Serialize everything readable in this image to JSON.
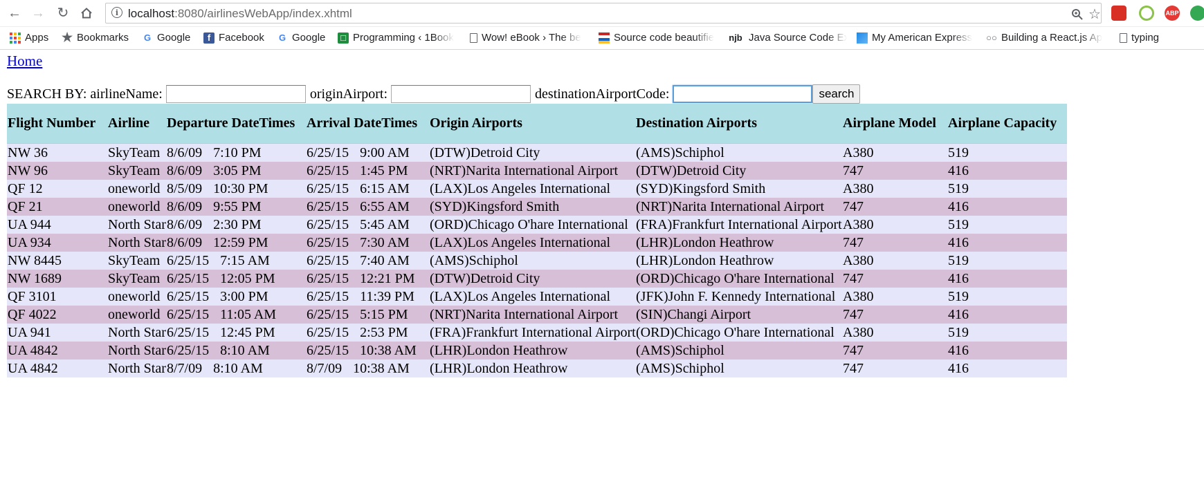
{
  "browser": {
    "url_host": "localhost",
    "url_path": ":8080/airlinesWebApp/index.xhtml",
    "extensions": [
      {
        "name": "red-book-extension",
        "color": "#d93025",
        "label": ""
      },
      {
        "name": "green-q-extension",
        "color": "#4caf50",
        "label": ""
      },
      {
        "name": "adblock-plus-extension",
        "color": "#e53935",
        "label": "ABP"
      },
      {
        "name": "green-circle-extension",
        "color": "#34a853",
        "label": ""
      }
    ]
  },
  "bookmarks": [
    {
      "label": "Apps"
    },
    {
      "label": "Bookmarks"
    },
    {
      "label": "Google"
    },
    {
      "label": "Facebook"
    },
    {
      "label": "Google"
    },
    {
      "label": "Programming ‹ 1Book"
    },
    {
      "label": "Wow! eBook › The be"
    },
    {
      "label": "Source code beautifie"
    },
    {
      "label": "Java Source Code Exa"
    },
    {
      "label": "My American Express"
    },
    {
      "label": "Building a React.js Ap"
    },
    {
      "label": "typing"
    }
  ],
  "bookmark_icons": {
    "google": "G",
    "facebook": "f",
    "njb": "njb"
  },
  "page": {
    "home_link": "Home",
    "search_by": "SEARCH BY: airlineName:",
    "origin_label": "originAirport:",
    "dest_label": "destinationAirportCode:",
    "search_button": "search",
    "airline_value": "",
    "origin_value": "",
    "dest_value": ""
  },
  "table": {
    "headers": [
      "Flight Number",
      "Airline",
      "Departure DateTimes",
      "Arrival DateTimes",
      "Origin Airports",
      "Destination Airports",
      "Airplane Model",
      "Airplane Capacity"
    ],
    "rows": [
      {
        "flight": "NW 36",
        "airline": "SkyTeam",
        "dep_date": "8/6/09",
        "dep_time": "7:10 PM",
        "arr_date": "6/25/15",
        "arr_time": "9:00 AM",
        "origin": "(DTW)Detroid City",
        "dest": "(AMS)Schiphol",
        "model": "A380",
        "capacity": "519"
      },
      {
        "flight": "NW 96",
        "airline": "SkyTeam",
        "dep_date": "8/6/09",
        "dep_time": "3:05 PM",
        "arr_date": "6/25/15",
        "arr_time": "1:45 PM",
        "origin": "(NRT)Narita International Airport",
        "dest": "(DTW)Detroid City",
        "model": "747",
        "capacity": "416"
      },
      {
        "flight": "QF 12",
        "airline": "oneworld",
        "dep_date": "8/5/09",
        "dep_time": "10:30 PM",
        "arr_date": "6/25/15",
        "arr_time": "6:15 AM",
        "origin": "(LAX)Los Angeles International",
        "dest": "(SYD)Kingsford Smith",
        "model": "A380",
        "capacity": "519"
      },
      {
        "flight": "QF 21",
        "airline": "oneworld",
        "dep_date": "8/6/09",
        "dep_time": "9:55 PM",
        "arr_date": "6/25/15",
        "arr_time": "6:55 AM",
        "origin": "(SYD)Kingsford Smith",
        "dest": "(NRT)Narita International Airport",
        "model": "747",
        "capacity": "416"
      },
      {
        "flight": "UA 944",
        "airline": "North Star",
        "dep_date": "8/6/09",
        "dep_time": "2:30 PM",
        "arr_date": "6/25/15",
        "arr_time": "5:45 AM",
        "origin": "(ORD)Chicago O'hare International",
        "dest": "(FRA)Frankfurt International Airport",
        "model": "A380",
        "capacity": "519"
      },
      {
        "flight": "UA 934",
        "airline": "North Star",
        "dep_date": "8/6/09",
        "dep_time": "12:59 PM",
        "arr_date": "6/25/15",
        "arr_time": "7:30 AM",
        "origin": "(LAX)Los Angeles International",
        "dest": "(LHR)London Heathrow",
        "model": "747",
        "capacity": "416"
      },
      {
        "flight": "NW 8445",
        "airline": "SkyTeam",
        "dep_date": "6/25/15",
        "dep_time": "7:15 AM",
        "arr_date": "6/25/15",
        "arr_time": "7:40 AM",
        "origin": "(AMS)Schiphol",
        "dest": "(LHR)London Heathrow",
        "model": "A380",
        "capacity": "519"
      },
      {
        "flight": "NW 1689",
        "airline": "SkyTeam",
        "dep_date": "6/25/15",
        "dep_time": "12:05 PM",
        "arr_date": "6/25/15",
        "arr_time": "12:21 PM",
        "origin": "(DTW)Detroid City",
        "dest": "(ORD)Chicago O'hare International",
        "model": "747",
        "capacity": "416"
      },
      {
        "flight": "QF 3101",
        "airline": "oneworld",
        "dep_date": "6/25/15",
        "dep_time": "3:00 PM",
        "arr_date": "6/25/15",
        "arr_time": "11:39 PM",
        "origin": "(LAX)Los Angeles International",
        "dest": "(JFK)John F. Kennedy International",
        "model": "A380",
        "capacity": "519"
      },
      {
        "flight": "QF 4022",
        "airline": "oneworld",
        "dep_date": "6/25/15",
        "dep_time": "11:05 AM",
        "arr_date": "6/25/15",
        "arr_time": "5:15 PM",
        "origin": "(NRT)Narita International Airport",
        "dest": "(SIN)Changi Airport",
        "model": "747",
        "capacity": "416"
      },
      {
        "flight": "UA 941",
        "airline": "North Star",
        "dep_date": "6/25/15",
        "dep_time": "12:45 PM",
        "arr_date": "6/25/15",
        "arr_time": "2:53 PM",
        "origin": "(FRA)Frankfurt International Airport",
        "dest": "(ORD)Chicago O'hare International",
        "model": "A380",
        "capacity": "519"
      },
      {
        "flight": "UA 4842",
        "airline": "North Star",
        "dep_date": "6/25/15",
        "dep_time": "8:10 AM",
        "arr_date": "6/25/15",
        "arr_time": "10:38 AM",
        "origin": "(LHR)London Heathrow",
        "dest": "(AMS)Schiphol",
        "model": "747",
        "capacity": "416"
      },
      {
        "flight": "UA 4842",
        "airline": "North Star",
        "dep_date": "8/7/09",
        "dep_time": "8:10 AM",
        "arr_date": "8/7/09",
        "arr_time": "10:38 AM",
        "origin": "(LHR)London Heathrow",
        "dest": "(AMS)Schiphol",
        "model": "747",
        "capacity": "416"
      }
    ]
  }
}
